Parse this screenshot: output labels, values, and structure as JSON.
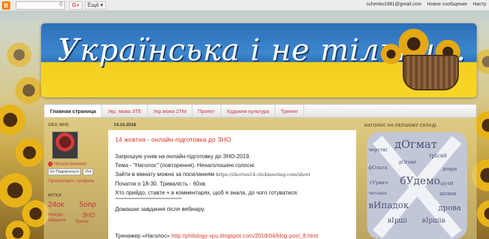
{
  "navbar": {
    "logo": "B",
    "search_icon": "magnifier-icon",
    "gplus_label": "G+",
    "more_label": "Ещё ▾",
    "right_items": [
      "schenko1981@gmail.com",
      "Новое сообщение",
      "Настр"
    ]
  },
  "header": {
    "title": "Українська і не тільки..."
  },
  "tabs": [
    {
      "label": "Главная страница",
      "active": true
    },
    {
      "label": "Укр. мова 3ТЕ",
      "active": false
    },
    {
      "label": "Укр.мова 2ТМ",
      "active": false
    },
    {
      "label": "Проект",
      "active": false
    },
    {
      "label": "Художня культура",
      "active": false
    },
    {
      "label": "Тренінг",
      "active": false
    }
  ],
  "left_sidebar": {
    "about_heading": "ОБО МНЕ",
    "author_name": "Наталія Іваненко",
    "follow_label": "G+ Подписаться",
    "follow_count": "254",
    "profile_link": "Просмотреть профиль",
    "tags_heading": "МІТКИ",
    "tags": [
      "24ок",
      "5опр",
      "ЗНО",
      "Конкурс",
      "завдання",
      "Тренінг"
    ]
  },
  "post": {
    "date": "14.10.2018",
    "title": "14 жовтня - онлайн-підготовка до ЗНО",
    "line1": "Запрошую учнів на онлайн-підготовку до ЗНО-2019.",
    "line2": "Тема - \"Наголос\" (повторення). Ненаголошені голосні.",
    "line3_prefix": "Зайти в кімнату можна за посиланням",
    "line3_link": "https://zhovten14.clickmeeting.com/zhovt",
    "line4": "Початок о 18-30. Тривалість - 60хв.",
    "line5": "Хто прийдо, ставте + в комментарях, щоб я знала, до чого готуватися.",
    "stars": "*****************************************************",
    "line6": "Домашнє завдання після вебінару.",
    "line7_prefix": "Тренажер «Наголос»",
    "line7_link": "http://philology-vpu.blogspot.com/2018/04/blog-post_8.html"
  },
  "right_sidebar": {
    "heading": "НАГОЛОС НА ПЕРШОМУ СКЛАДІ",
    "cloud_words": [
      "дОгмат",
      "черстві",
      "тріснё",
      "бУдемо",
      "фОльга",
      "гУрвич",
      "довра",
      "дрова",
      "вИпадок",
      "шляхи",
      "вІрші",
      "вІршів",
      "читання",
      "зручИ",
      "дОгомі"
    ]
  }
}
